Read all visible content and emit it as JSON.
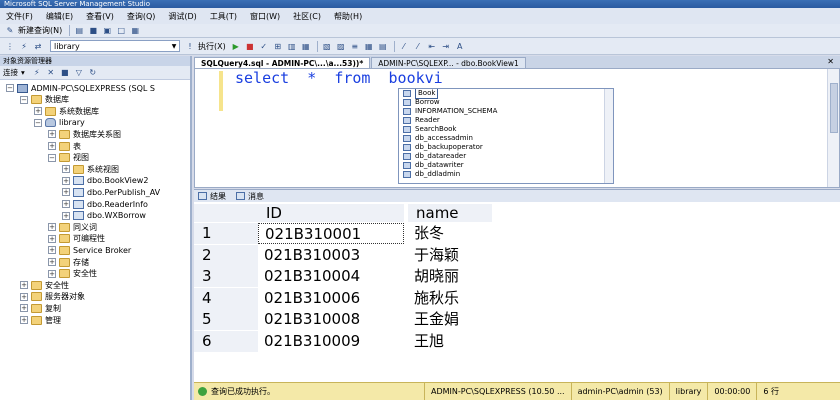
{
  "window": {
    "title": "Microsoft SQL Server Management Studio"
  },
  "menu": [
    "文件(F)",
    "编辑(E)",
    "查看(V)",
    "查询(Q)",
    "调试(D)",
    "工具(T)",
    "窗口(W)",
    "社区(C)",
    "帮助(H)"
  ],
  "toolbar": {
    "new_query": "新建查询(N)",
    "database": "library",
    "execute": "执行(X)"
  },
  "object_explorer": {
    "title": "对象资源管理器",
    "connect": "连接",
    "tree": [
      {
        "label": "ADMIN-PC\\SQLEXPRESS (SQL S",
        "level": 0,
        "icon": "server",
        "expanded": true
      },
      {
        "label": "数据库",
        "level": 1,
        "icon": "folder",
        "expanded": true
      },
      {
        "label": "系统数据库",
        "level": 2,
        "icon": "folder",
        "expanded": false
      },
      {
        "label": "library",
        "level": 2,
        "icon": "database",
        "expanded": true
      },
      {
        "label": "数据库关系图",
        "level": 3,
        "icon": "folder",
        "expanded": false
      },
      {
        "label": "表",
        "level": 3,
        "icon": "folder",
        "expanded": false
      },
      {
        "label": "视图",
        "level": 3,
        "icon": "folder",
        "expanded": true
      },
      {
        "label": "系统视图",
        "level": 4,
        "icon": "folder",
        "expanded": false
      },
      {
        "label": "dbo.BookView2",
        "level": 4,
        "icon": "view",
        "expanded": false
      },
      {
        "label": "dbo.PerPublish_AV",
        "level": 4,
        "icon": "view",
        "expanded": false
      },
      {
        "label": "dbo.ReaderInfo",
        "level": 4,
        "icon": "view",
        "expanded": false
      },
      {
        "label": "dbo.WXBorrow",
        "level": 4,
        "icon": "view",
        "expanded": false
      },
      {
        "label": "同义词",
        "level": 3,
        "icon": "folder",
        "expanded": false
      },
      {
        "label": "可编程性",
        "level": 3,
        "icon": "folder",
        "expanded": false
      },
      {
        "label": "Service Broker",
        "level": 3,
        "icon": "folder",
        "expanded": false
      },
      {
        "label": "存储",
        "level": 3,
        "icon": "folder",
        "expanded": false
      },
      {
        "label": "安全性",
        "level": 3,
        "icon": "folder",
        "expanded": false
      },
      {
        "label": "安全性",
        "level": 1,
        "icon": "folder",
        "expanded": false
      },
      {
        "label": "服务器对象",
        "level": 1,
        "icon": "folder",
        "expanded": false
      },
      {
        "label": "复制",
        "level": 1,
        "icon": "folder",
        "expanded": false
      },
      {
        "label": "管理",
        "level": 1,
        "icon": "folder",
        "expanded": false
      }
    ]
  },
  "tabs": [
    {
      "label": "SQLQuery4.sql - ADMIN-PC\\...\\a...53))*",
      "active": true
    },
    {
      "label": "ADMIN-PC\\SQLEXP... - dbo.BookView1",
      "active": false
    }
  ],
  "editor": {
    "sql": "select  *  from  bookvi"
  },
  "intellisense": {
    "items": [
      "Book",
      "Borrow",
      "INFORMATION_SCHEMA",
      "Reader",
      "SearchBook",
      "db_accessadmin",
      "db_backupoperator",
      "db_datareader",
      "db_datawriter",
      "db_ddladmin"
    ]
  },
  "results": {
    "tabs": [
      "结果",
      "消息"
    ],
    "columns": [
      "ID",
      "name"
    ],
    "rows": [
      [
        "1",
        "021B310001",
        "张冬"
      ],
      [
        "2",
        "021B310003",
        "于海颖"
      ],
      [
        "3",
        "021B310004",
        "胡晓丽"
      ],
      [
        "4",
        "021B310006",
        "施秋乐"
      ],
      [
        "5",
        "021B310008",
        "王金娟"
      ],
      [
        "6",
        "021B310009",
        "王旭"
      ]
    ]
  },
  "status": {
    "message": "查询已成功执行。",
    "server": "ADMIN-PC\\SQLEXPRESS (10.50 ...",
    "user": "admin-PC\\admin (53)",
    "database": "library",
    "time": "00:00:00",
    "rows": "6 行"
  }
}
